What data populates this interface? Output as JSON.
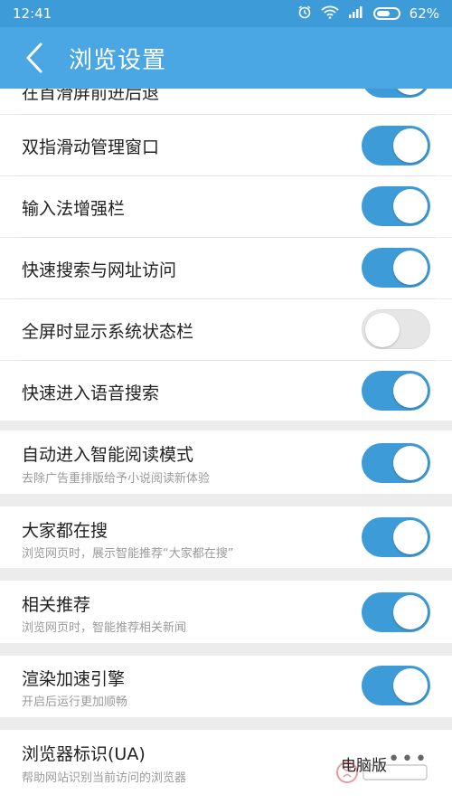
{
  "status": {
    "time": "12:41",
    "battery": "62%"
  },
  "header": {
    "title": "浏览设置"
  },
  "rows": [
    {
      "label": "在首滑屏前进后退",
      "on": true
    },
    {
      "label": "双指滑动管理窗口",
      "on": true
    },
    {
      "label": "输入法增强栏",
      "on": true
    },
    {
      "label": "快速搜索与网址访问",
      "on": true
    },
    {
      "label": "全屏时显示系统状态栏",
      "on": false
    },
    {
      "label": "快速进入语音搜索",
      "on": true
    }
  ],
  "sections": [
    {
      "label": "自动进入智能阅读模式",
      "sub": "去除广告重排版给予小说阅读新体验",
      "on": true
    },
    {
      "label": "大家都在搜",
      "sub": "浏览网页时，展示智能推荐“大家都在搜”",
      "on": true
    },
    {
      "label": "相关推荐",
      "sub": "浏览网页时，智能推荐相关新闻",
      "on": true
    },
    {
      "label": "渲染加速引擎",
      "sub": "开启后运行更加顺畅",
      "on": true
    }
  ],
  "ua": {
    "label": "浏览器标识(UA)",
    "sub": "帮助网站识别当前访问的浏览器",
    "value": "电脑版"
  },
  "colors": {
    "accent": "#3d9bd8",
    "header": "#4aa7e4"
  }
}
